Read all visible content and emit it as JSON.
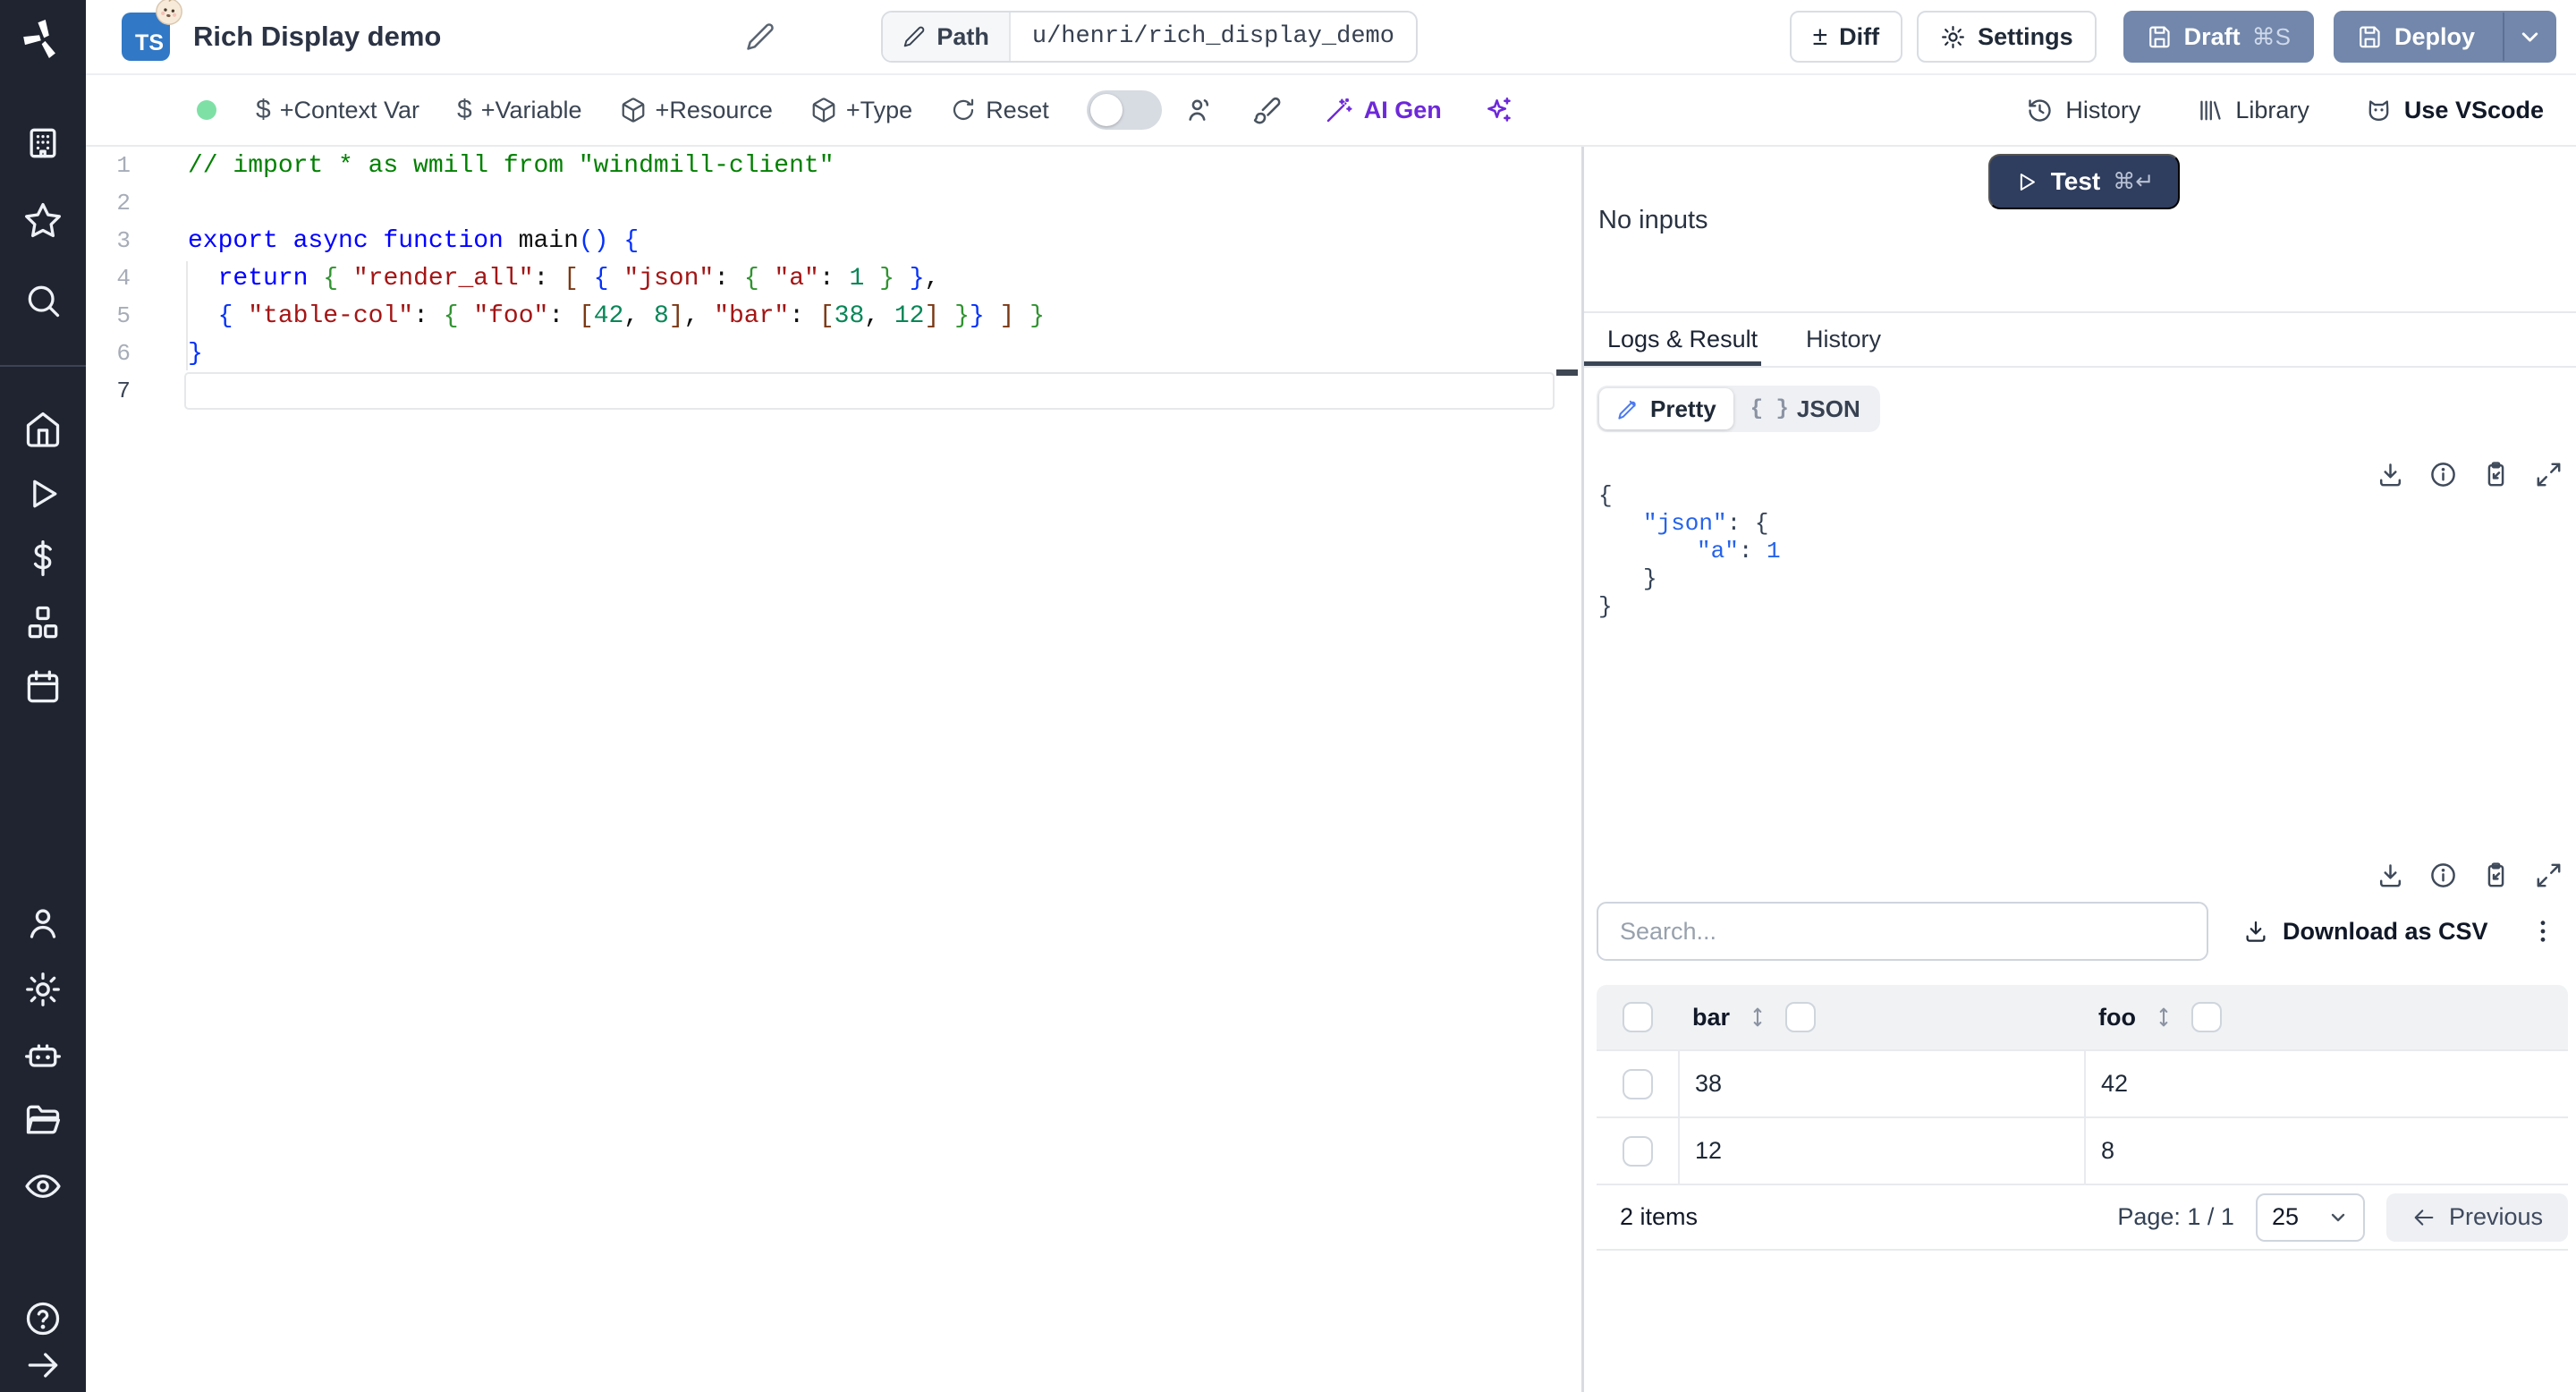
{
  "header": {
    "script_type": "TS",
    "title": "Rich Display demo",
    "path_label": "Path",
    "path_value": "u/henri/rich_display_demo",
    "diff_label": "Diff",
    "settings_label": "Settings",
    "draft_label": "Draft",
    "draft_shortcut": "⌘S",
    "deploy_label": "Deploy"
  },
  "toolbar": {
    "context_var": "+Context Var",
    "variable": "+Variable",
    "resource": "+Resource",
    "type": "+Type",
    "reset": "Reset",
    "ai_gen": "AI Gen",
    "history": "History",
    "library": "Library",
    "use_vscode": "Use VScode"
  },
  "sidebar": {
    "icons": [
      "buildings",
      "star",
      "search",
      "home",
      "play",
      "dollar",
      "cubes",
      "calendar",
      "user",
      "gear",
      "robot",
      "folder",
      "eye",
      "help",
      "arrow-right"
    ]
  },
  "editor": {
    "lines": [
      {
        "tokens": [
          [
            "// import * as wmill from \"windmill-client\"",
            "comment"
          ]
        ]
      },
      {
        "tokens": []
      },
      {
        "tokens": [
          [
            "export async function",
            "kw"
          ],
          [
            " ",
            ""
          ],
          [
            "main",
            "fn"
          ],
          [
            "(",
            "b1"
          ],
          [
            ")",
            "b1"
          ],
          [
            " ",
            ""
          ],
          [
            "{",
            "b1"
          ]
        ]
      },
      {
        "tokens": [
          [
            "  ",
            ""
          ],
          [
            "return",
            "kw"
          ],
          [
            " ",
            ""
          ],
          [
            "{",
            "b2"
          ],
          [
            " ",
            ""
          ],
          [
            "\"render_all\"",
            "str"
          ],
          [
            ": ",
            "pl"
          ],
          [
            "[",
            "b3"
          ],
          [
            " ",
            ""
          ],
          [
            "{",
            "b1"
          ],
          [
            " ",
            ""
          ],
          [
            "\"json\"",
            "str"
          ],
          [
            ": ",
            "pl"
          ],
          [
            "{",
            "b2"
          ],
          [
            " ",
            ""
          ],
          [
            "\"a\"",
            "str"
          ],
          [
            ": ",
            "pl"
          ],
          [
            "1",
            "num"
          ],
          [
            " ",
            ""
          ],
          [
            "}",
            "b2"
          ],
          [
            " ",
            ""
          ],
          [
            "}",
            "b1"
          ],
          [
            ",",
            "pl"
          ]
        ]
      },
      {
        "tokens": [
          [
            "  ",
            ""
          ],
          [
            "{",
            "b1"
          ],
          [
            " ",
            ""
          ],
          [
            "\"table-col\"",
            "str"
          ],
          [
            ": ",
            "pl"
          ],
          [
            "{",
            "b2"
          ],
          [
            " ",
            ""
          ],
          [
            "\"foo\"",
            "str"
          ],
          [
            ": ",
            "pl"
          ],
          [
            "[",
            "b3"
          ],
          [
            "42",
            "num"
          ],
          [
            ", ",
            "pl"
          ],
          [
            "8",
            "num"
          ],
          [
            "]",
            "b3"
          ],
          [
            ", ",
            "pl"
          ],
          [
            "\"bar\"",
            "str"
          ],
          [
            ": ",
            "pl"
          ],
          [
            "[",
            "b3"
          ],
          [
            "38",
            "num"
          ],
          [
            ", ",
            "pl"
          ],
          [
            "12",
            "num"
          ],
          [
            "]",
            "b3"
          ],
          [
            " ",
            ""
          ],
          [
            "}",
            "b2"
          ],
          [
            "}",
            "b1"
          ],
          [
            " ",
            ""
          ],
          [
            "]",
            "b3"
          ],
          [
            " ",
            ""
          ],
          [
            "}",
            "b2"
          ]
        ]
      },
      {
        "tokens": [
          [
            "}",
            "b1"
          ]
        ]
      },
      {
        "tokens": []
      }
    ],
    "active_line": 7
  },
  "run": {
    "test_label": "Test",
    "test_shortcut": "⌘↵",
    "no_inputs": "No inputs"
  },
  "tabs": {
    "logs_result": "Logs & Result",
    "history": "History"
  },
  "result": {
    "pretty_label": "Pretty",
    "json_braces": "{ }",
    "json_label": "JSON",
    "lines": [
      {
        "indent": 0,
        "parts": [
          [
            "{",
            "b"
          ]
        ]
      },
      {
        "indent": 50,
        "parts": [
          [
            "\"json\"",
            "k"
          ],
          [
            ": ",
            "p"
          ],
          [
            "{",
            "b"
          ]
        ]
      },
      {
        "indent": 110,
        "parts": [
          [
            "\"a\"",
            "k"
          ],
          [
            ": ",
            "p"
          ],
          [
            "1",
            "v"
          ]
        ]
      },
      {
        "indent": 50,
        "parts": [
          [
            "}",
            "b"
          ]
        ]
      },
      {
        "indent": 0,
        "parts": [
          [
            "}",
            "b"
          ]
        ]
      }
    ]
  },
  "table": {
    "search_placeholder": "Search...",
    "download_csv_label": "Download as CSV",
    "headers": [
      "bar",
      "foo"
    ],
    "rows": [
      [
        "38",
        "42"
      ],
      [
        "12",
        "8"
      ]
    ],
    "items_label": "2 items",
    "page_label": "Page: 1 / 1",
    "page_size": "25",
    "previous_label": "Previous"
  },
  "colors": {
    "sidebar_bg": "#1f2430",
    "ts_badge": "#3178c6",
    "primary_button": "#7287ab",
    "test_button": "#2f3d5e",
    "ai_purple": "#6d28d9",
    "status_green": "#7fe0a6",
    "tab_underline": "#3a4554",
    "code": {
      "comment": "#008000",
      "kw": "#0000ff",
      "fn": "#111111",
      "str": "#a31515",
      "num": "#098658",
      "b1": "#0431fa",
      "b2": "#319331",
      "b3": "#7b3814",
      "pl": "#111111",
      "": "#111111"
    },
    "json_view": {
      "k": "#2563eb",
      "v": "#2563eb",
      "b": "#334155",
      "p": "#334155"
    }
  }
}
